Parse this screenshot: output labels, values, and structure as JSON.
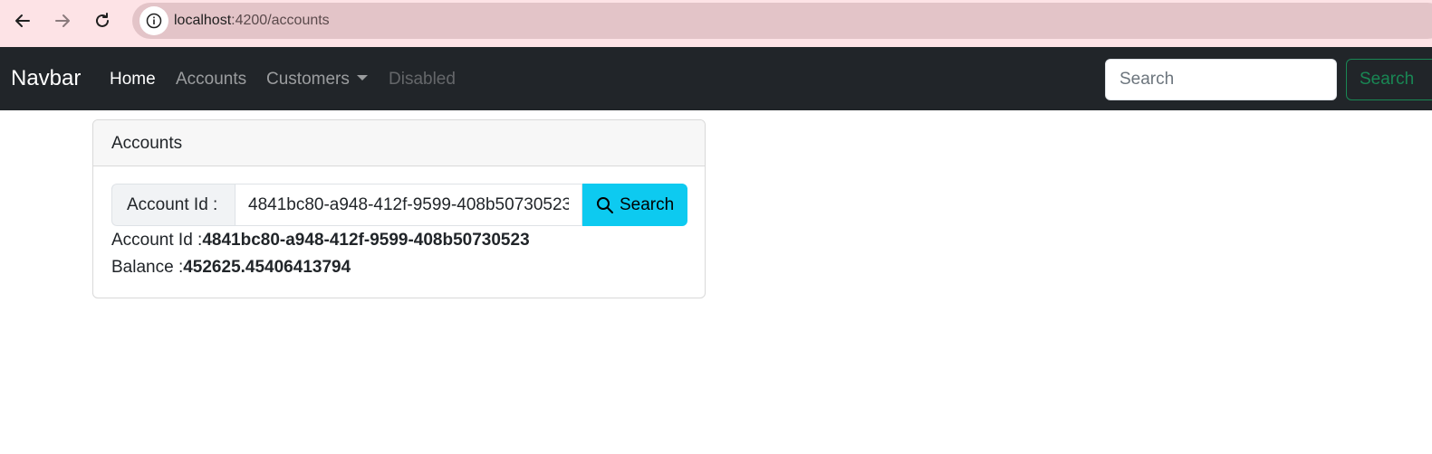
{
  "browser": {
    "url_host": "localhost",
    "url_path": ":4200/accounts",
    "icons": [
      "back-arrow-icon",
      "forward-arrow-icon",
      "reload-icon",
      "site-info-icon"
    ]
  },
  "navbar": {
    "brand": "Navbar",
    "links": [
      {
        "label": "Home",
        "state": "active"
      },
      {
        "label": "Accounts",
        "state": "normal"
      },
      {
        "label": "Customers",
        "state": "dropdown"
      },
      {
        "label": "Disabled",
        "state": "disabled"
      }
    ],
    "search_placeholder": "Search",
    "search_button": "Search",
    "colors": {
      "background": "#212529",
      "search_button": "#198754"
    }
  },
  "card": {
    "header": "Accounts",
    "input_label": "Account Id :",
    "input_value": "4841bc80-a948-412f-9599-408b50730523",
    "search_button": "Search",
    "search_button_color": "#0dcaf0",
    "result": {
      "account_id_label": "Account Id :",
      "account_id_value": "4841bc80-a948-412f-9599-408b50730523",
      "balance_label": "Balance :",
      "balance_value": "452625.45406413794"
    }
  }
}
